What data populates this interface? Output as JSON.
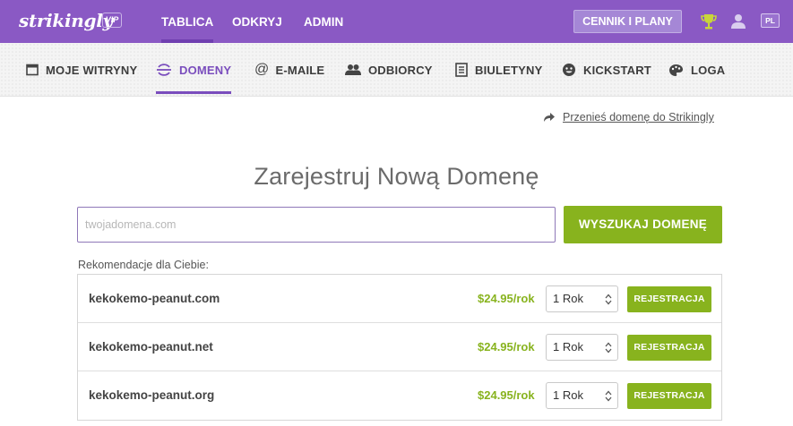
{
  "header": {
    "logo": "strikingly",
    "badge": "VIP",
    "nav": [
      {
        "label": "TABLICA",
        "active": true
      },
      {
        "label": "ODKRYJ",
        "active": false
      },
      {
        "label": "ADMIN",
        "active": false
      }
    ],
    "pricing_label": "CENNIK I PLANY",
    "icons": [
      "trophy-icon",
      "user-icon"
    ],
    "language": "PL",
    "brand_color": "#8a59c4"
  },
  "subnav": {
    "items": [
      {
        "label": "MOJE WITRYNY",
        "icon": "site-icon",
        "active": false
      },
      {
        "label": "DOMENY",
        "icon": "domain-icon",
        "active": true
      },
      {
        "label": "E-MAILE",
        "icon": "at-icon",
        "active": false
      },
      {
        "label": "ODBIORCY",
        "icon": "audience-icon",
        "active": false
      },
      {
        "label": "BIULETYNY",
        "icon": "newsletter-icon",
        "active": false
      },
      {
        "label": "KICKSTART",
        "icon": "kickstart-icon",
        "active": false
      },
      {
        "label": "LOGA",
        "icon": "palette-icon",
        "active": false
      }
    ],
    "accent_color": "#7a4dbd"
  },
  "transfer_link": "Przenieś domenę do Strikingly",
  "page_title": "Zarejestruj Nową Domenę",
  "search": {
    "placeholder": "twojadomena.com",
    "value": "",
    "button_label": "WYSZUKAJ DOMENĘ"
  },
  "recommendations_label": "Rekomendacje dla Ciebie:",
  "results": [
    {
      "domain": "kekokemo-peanut.com",
      "price": "$24.95/rok",
      "period": "1 Rok",
      "button": "REJESTRACJA"
    },
    {
      "domain": "kekokemo-peanut.net",
      "price": "$24.95/rok",
      "period": "1 Rok",
      "button": "REJESTRACJA"
    },
    {
      "domain": "kekokemo-peanut.org",
      "price": "$24.95/rok",
      "period": "1 Rok",
      "button": "REJESTRACJA"
    }
  ],
  "action_color": "#88b31e"
}
